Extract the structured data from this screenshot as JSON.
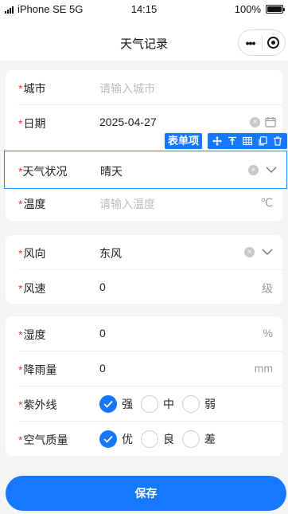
{
  "status_bar": {
    "carrier": "iPhone SE 5G",
    "time": "14:15",
    "battery": "100%"
  },
  "nav": {
    "title": "天气记录"
  },
  "form": {
    "city": {
      "label": "城市",
      "placeholder": "请输入城市"
    },
    "date": {
      "label": "日期",
      "value": "2025-04-27"
    },
    "weather": {
      "label": "天气状况",
      "value": "晴天"
    },
    "temperature": {
      "label": "温度",
      "placeholder": "请输入温度",
      "unit": "℃"
    },
    "wind_direction": {
      "label": "风向",
      "value": "东风"
    },
    "wind_speed": {
      "label": "风速",
      "value": "0",
      "unit": "级"
    },
    "humidity": {
      "label": "湿度",
      "value": "0",
      "unit": "%"
    },
    "rainfall": {
      "label": "降雨量",
      "value": "0",
      "unit": "mm"
    },
    "uv": {
      "label": "紫外线",
      "options": [
        "强",
        "中",
        "弱"
      ],
      "selected": "强"
    },
    "air_quality": {
      "label": "空气质量",
      "options": [
        "优",
        "良",
        "差"
      ],
      "selected": "优"
    }
  },
  "designer": {
    "badge": "表单项"
  },
  "actions": {
    "save": "保存"
  },
  "colors": {
    "primary": "#1677ff",
    "required": "#e53935",
    "placeholder": "#bdbdbd"
  }
}
